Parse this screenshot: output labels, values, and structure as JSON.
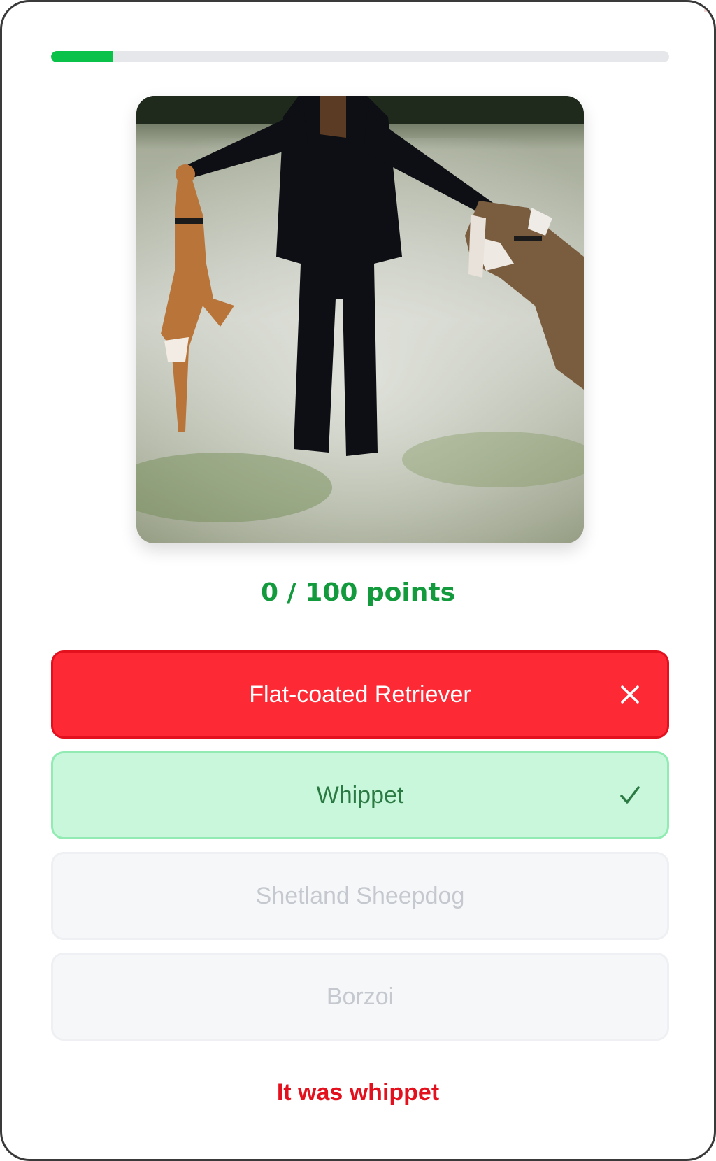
{
  "progress": {
    "fraction": 0.1
  },
  "photo": {
    "alt": "Person in a snowy field holding hands with two dogs jumping up on hind legs"
  },
  "score": {
    "text": "0 / 100 points"
  },
  "options": [
    {
      "label": "Flat-coated Retriever",
      "state": "wrong",
      "mark_icon": "close-icon"
    },
    {
      "label": "Whippet",
      "state": "correct",
      "mark_icon": "check-icon"
    },
    {
      "label": "Shetland Sheepdog",
      "state": "disabled"
    },
    {
      "label": "Borzoi",
      "state": "disabled"
    }
  ],
  "feedback": {
    "text": "It was whippet"
  },
  "colors": {
    "accent_green": "#0ac24a",
    "score_green": "#129a3c",
    "wrong_red": "#fd2a36",
    "correct_bg": "#c8f7db",
    "feedback_red": "#e3101d"
  }
}
